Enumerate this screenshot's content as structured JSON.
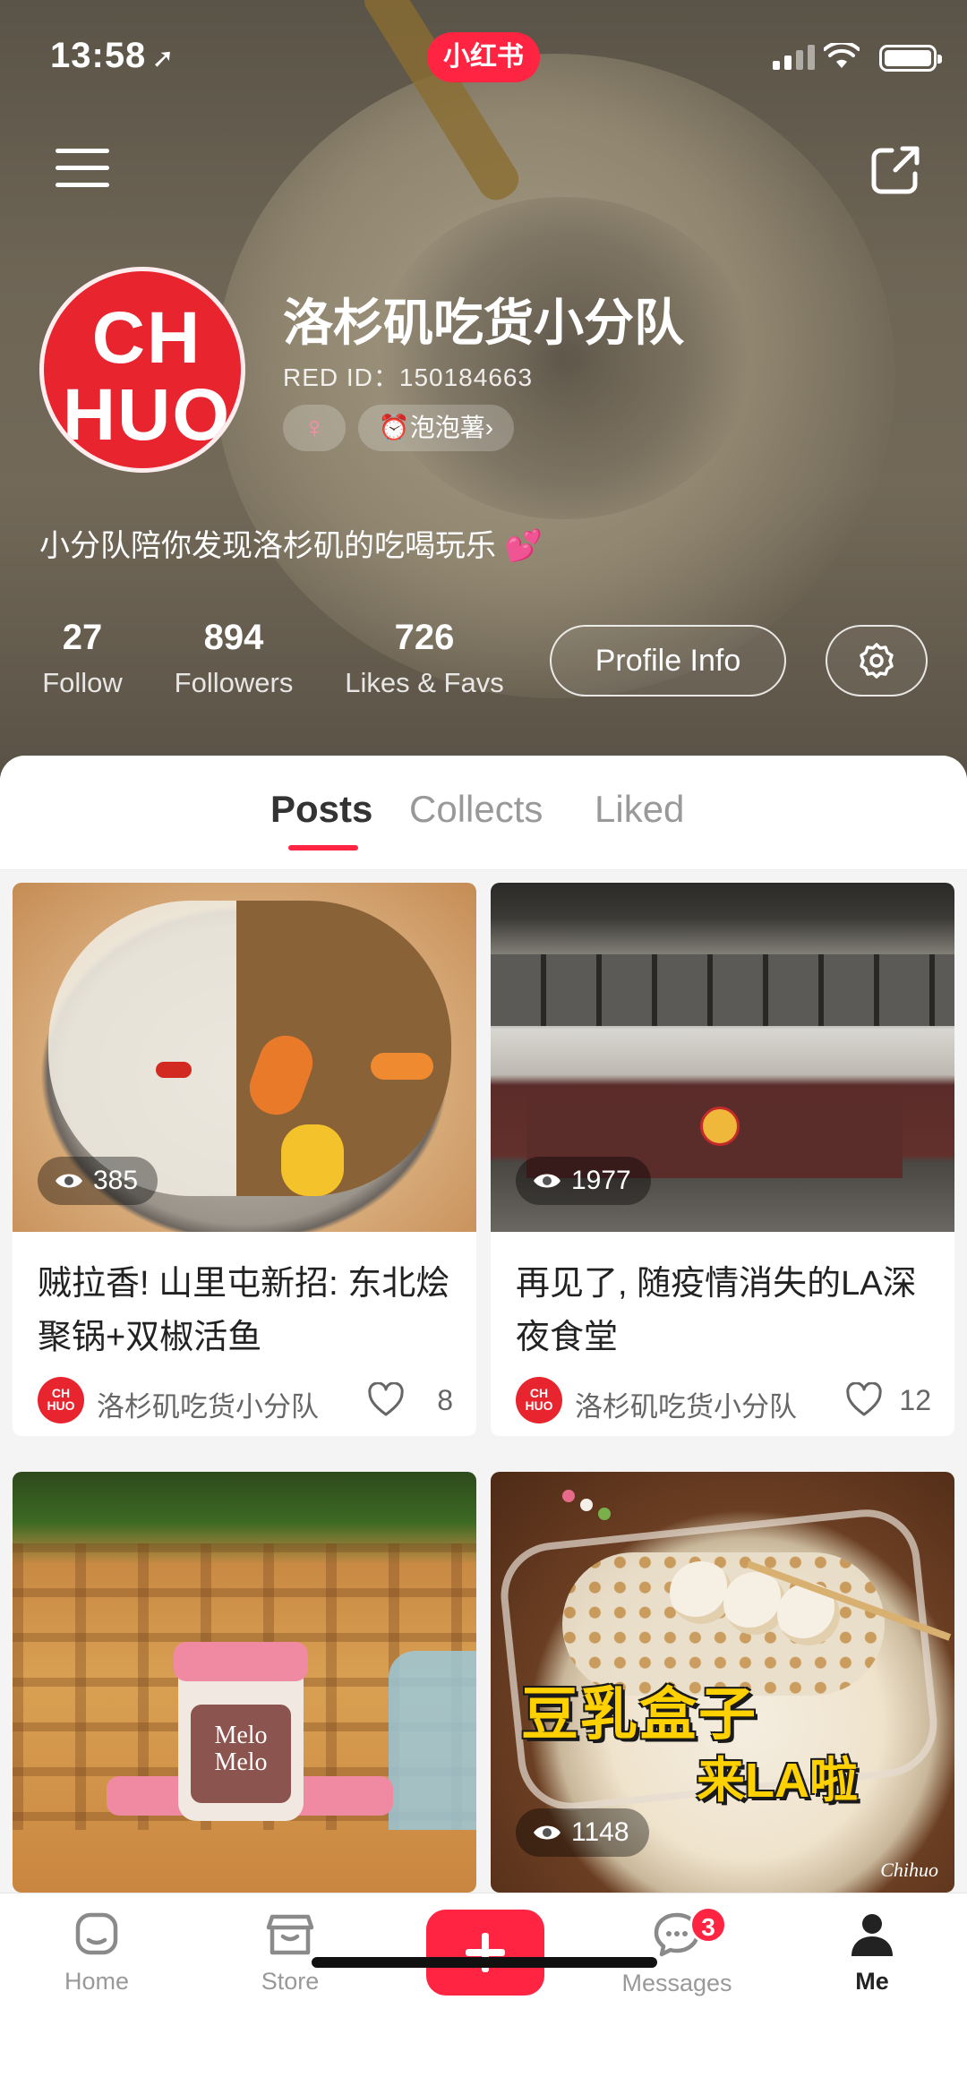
{
  "status_bar": {
    "time": "13:58",
    "app_badge": "小红书"
  },
  "profile": {
    "nickname": "洛杉矶吃货小分队",
    "red_id": "RED ID：150184663",
    "gender_symbol": "♀",
    "level_badge": "泡泡薯",
    "bio": "小分队陪你发现洛杉矶的吃喝玩乐 💕",
    "avatar_text_line1": "CH",
    "avatar_text_line2": "HUO",
    "stats": [
      {
        "num": "27",
        "label": "Follow"
      },
      {
        "num": "894",
        "label": "Followers"
      },
      {
        "num": "726",
        "label": "Likes & Favs"
      }
    ],
    "profile_info_label": "Profile Info"
  },
  "tabs": [
    {
      "label": "Posts",
      "active": true
    },
    {
      "label": "Collects",
      "active": false
    },
    {
      "label": "Liked",
      "active": false
    }
  ],
  "posts": [
    {
      "views": "385",
      "title": "贼拉香! 山里屯新招: 东北烩聚锅+双椒活鱼",
      "author": "洛杉矶吃货小分队",
      "likes": "8",
      "image": "hotpot"
    },
    {
      "views": "1977",
      "title": "再见了, 随疫情消失的LA深夜食堂",
      "author": "洛杉矶吃货小分队",
      "likes": "12",
      "image": "restaurant"
    },
    {
      "views": "",
      "title": "",
      "author": "",
      "likes": "",
      "image": "jars",
      "image_text": "Melo Melo"
    },
    {
      "views": "1148",
      "title": "",
      "author": "",
      "likes": "",
      "image": "dessert",
      "image_text_1": "豆乳盒子",
      "image_text_2": "来LA啦",
      "watermark": "Chihuo"
    }
  ],
  "tabbar": {
    "items": [
      {
        "label": "Home",
        "icon": "home-icon"
      },
      {
        "label": "Store",
        "icon": "store-icon"
      },
      {
        "label": "",
        "icon": "plus-icon"
      },
      {
        "label": "Messages",
        "icon": "chat-icon",
        "badge": "3"
      },
      {
        "label": "Me",
        "icon": "person-icon",
        "active": true
      }
    ]
  },
  "colors": {
    "brand_red": "#ff2442",
    "avatar_red": "#e8242e"
  }
}
